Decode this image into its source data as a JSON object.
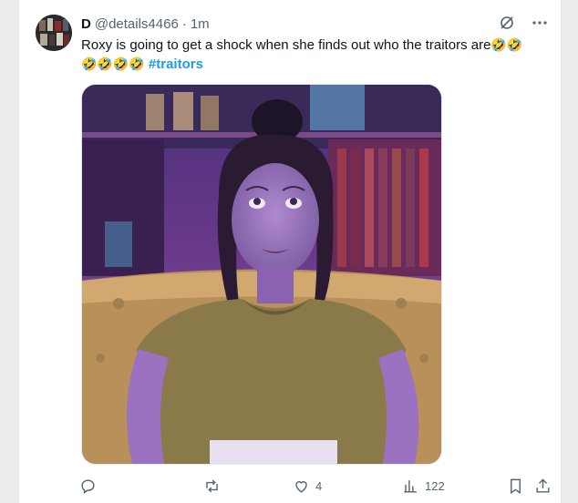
{
  "tweet": {
    "display_name": "D",
    "handle": "@details4466",
    "separator": "·",
    "time": "1m",
    "text": "Roxy is going to get a shock when she finds out who the traitors are",
    "text_emojis_1": "🤣🤣",
    "text_emojis_2": "🤣🤣🤣🤣",
    "hashtag": "#traitors",
    "media_alt": "Woman on a sofa looking up, wide-eyed"
  },
  "actions": {
    "reply_count": "",
    "retweet_count": "",
    "like_count": "4",
    "views_count": "122"
  },
  "icons": {
    "grok": "grok-icon",
    "more": "more-icon",
    "reply": "reply-icon",
    "retweet": "retweet-icon",
    "like": "like-icon",
    "views": "views-icon",
    "bookmark": "bookmark-icon",
    "share": "share-icon"
  },
  "colors": {
    "text": "#0f1419",
    "secondary": "#536471",
    "link": "#1d9bf0"
  }
}
